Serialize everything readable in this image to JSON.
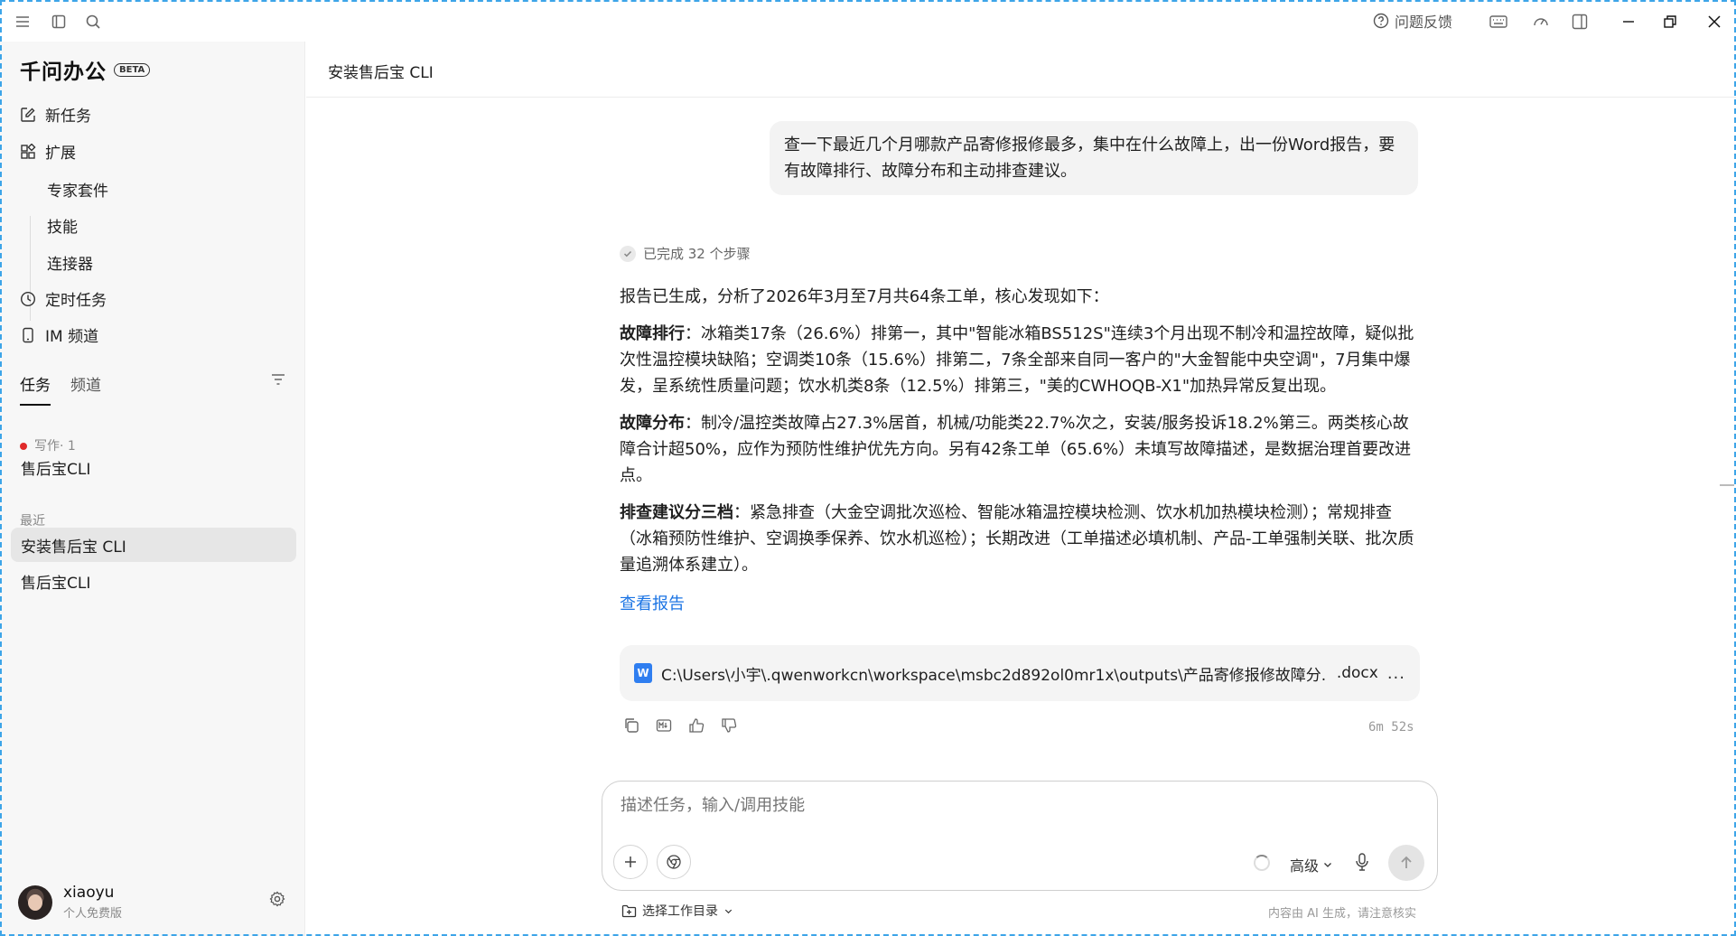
{
  "topbar": {
    "feedback_label": "问题反馈"
  },
  "sidebar": {
    "brand": "千问办公",
    "badge": "BETA",
    "nav": {
      "new_task": "新任务",
      "extensions": "扩展",
      "expert_suite": "专家套件",
      "skills": "技能",
      "connectors": "连接器",
      "scheduled": "定时任务",
      "im_channel": "IM 频道"
    },
    "tabs": {
      "tasks": "任务",
      "channels": "频道"
    },
    "writing_label": "写作· 1",
    "writing_item": "售后宝CLI",
    "recent_label": "最近",
    "recent_items": [
      "安装售后宝 CLI",
      "售后宝CLI"
    ],
    "user": {
      "name": "xiaoyu",
      "plan": "个人免费版"
    }
  },
  "main": {
    "title": "安装售后宝 CLI",
    "user_message": "查一下最近几个月哪款产品寄修报修最多，集中在什么故障上，出一份Word报告，要有故障排行、故障分布和主动排查建议。",
    "steps_label": "已完成 32 个步骤",
    "intro": "报告已生成，分析了2026年3月至7月共64条工单，核心发现如下：",
    "sections": [
      {
        "heading": "故障排行",
        "body": "：冰箱类17条（26.6%）排第一，其中\"智能冰箱BS512S\"连续3个月出现不制冷和温控故障，疑似批次性温控模块缺陷；空调类10条（15.6%）排第二，7条全部来自同一客户的\"大金智能中央空调\"，7月集中爆发，呈系统性质量问题；饮水机类8条（12.5%）排第三，\"美的CWHOQB-X1\"加热异常反复出现。"
      },
      {
        "heading": "故障分布",
        "body": "：制冷/温控类故障占27.3%居首，机械/功能类22.7%次之，安装/服务投诉18.2%第三。两类核心故障合计超50%，应作为预防性维护优先方向。另有42条工单（65.6%）未填写故障描述，是数据治理首要改进点。"
      },
      {
        "heading": "排查建议分三档",
        "body": "：紧急排查（大金空调批次巡检、智能冰箱温控模块检测、饮水机加热模块检测）；常规排查（冰箱预防性维护、空调换季保养、饮水机巡检）；长期改进（工单描述必填机制、产品-工单强制关联、批次质量追溯体系建立）。"
      }
    ],
    "view_report": "查看报告",
    "file": {
      "path": "C:\\Users\\小宇\\.qwenworkcn\\workspace\\msbc2d892ol0mr1x\\outputs\\产品寄修报修故障分...",
      "ext": ".docx",
      "icon_letter": "W",
      "more": "..."
    },
    "duration": "6m 52s"
  },
  "composer": {
    "placeholder": "描述任务，输入/调用技能",
    "level": "高级",
    "workdir": "选择工作目录",
    "disclaimer": "内容由 AI 生成，请注意核实"
  }
}
